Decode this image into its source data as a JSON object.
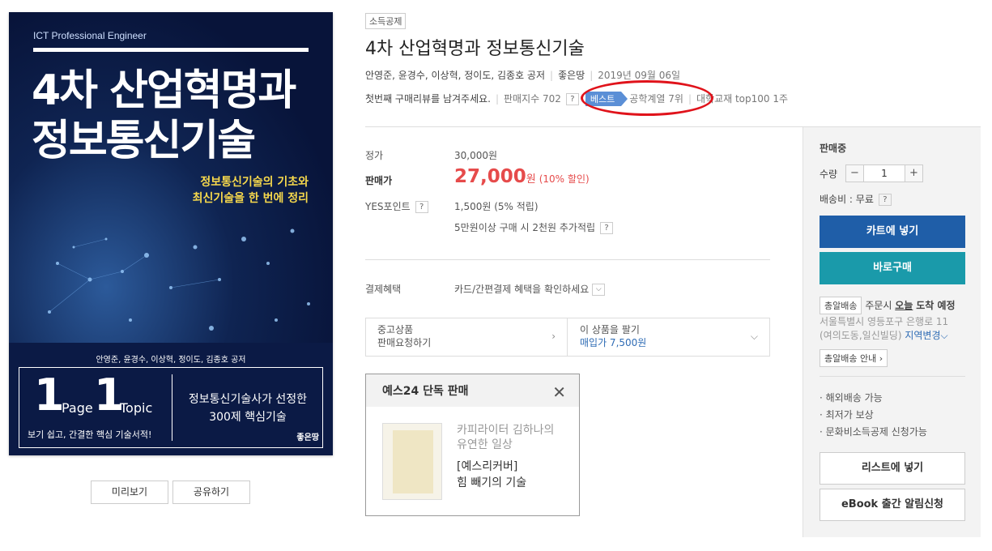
{
  "cover": {
    "series": "ICT Professional Engineer",
    "title_line1": "4차 산업혁명과",
    "title_line2": "정보통신기술",
    "subtitle_line1": "정보통신기술의 기초와",
    "subtitle_line2": "최신기술을 한 번에 정리",
    "authors": "안영준, 윤경수, 이상혁, 정이도, 김종호 공저",
    "one_a": "1",
    "page_label": "Page",
    "one_b": "1",
    "topic_label": "Topic",
    "tagline": "보기 쉽고, 간결한 핵심 기술서적!",
    "right_line1": "정보통신기술사가 선정한",
    "right_line2": "300제 핵심기술",
    "publisher": "좋은땅"
  },
  "cover_actions": {
    "preview": "미리보기",
    "share": "공유하기"
  },
  "product": {
    "tag": "소득공제",
    "title": "4차 산업혁명과 정보통신기술",
    "authors": "안영준, 윤경수, 이상혁, 정이도, 김종호 공저",
    "publisher": "좋은땅",
    "date": "2019년 09월 06일",
    "review": "첫번째 구매리뷰를 남겨주세요.",
    "sales_index": "판매지수 702",
    "best_label": "베스트",
    "rank": "공학계열 7위",
    "rank2": "대학교재 top100 1주"
  },
  "pricing": {
    "list_label": "정가",
    "list_value": "30,000원",
    "sale_label": "판매가",
    "sale_value": "27,000",
    "sale_unit": "원",
    "discount": "(10% 할인)",
    "points_label": "YES포인트",
    "points_value": "1,500원 (5% 적립)",
    "points_extra": "5만원이상 구매 시 2천원 추가적립",
    "help": "?"
  },
  "payment": {
    "label": "결제혜택",
    "value": "카드/간편결제 혜택을 확인하세요",
    "toggle": "⌵"
  },
  "used": {
    "c1_line1": "중고상품",
    "c1_line2": "판매요청하기",
    "c1_chev": "›",
    "c2_line1": "이 상품을 팔기",
    "c2_line2": "매입가 7,500원",
    "c2_chev": "⌵"
  },
  "exclusive": {
    "header": "예스24 단독 판매",
    "close": "✕",
    "line1": "카피라이터 김하나의",
    "line2": "유연한 일상",
    "line3": "[예스리커버]",
    "line4": "힘 빼기의 기술"
  },
  "panel": {
    "status": "판매중",
    "qty_label": "수량",
    "minus": "−",
    "qty": "1",
    "plus": "+",
    "shipping": "배송비 : 무료",
    "help": "?",
    "cart": "카트에 넣기",
    "buy": "바로구매",
    "delivery_tag": "총알배송",
    "order_pre": "주문시",
    "today": "오늘",
    "arrive": "도착 예정",
    "address1": "서울특별시 영등포구 은행로 11",
    "address2": "(여의도동,일신빌딩)",
    "region_change": "지역변경",
    "delivery_info": "총알배송 안내",
    "bullet1": "해외배송 가능",
    "bullet2": "최저가 보상",
    "bullet3": "문화비소득공제 신청가능",
    "wishlist": "리스트에 넣기",
    "ebook": "eBook 출간 알림신청"
  },
  "colors": {
    "cart_btn": "#1f5ea8",
    "buy_btn": "#1a9aaa",
    "price": "#e64b4b",
    "highlight_ring": "#e0131b"
  }
}
